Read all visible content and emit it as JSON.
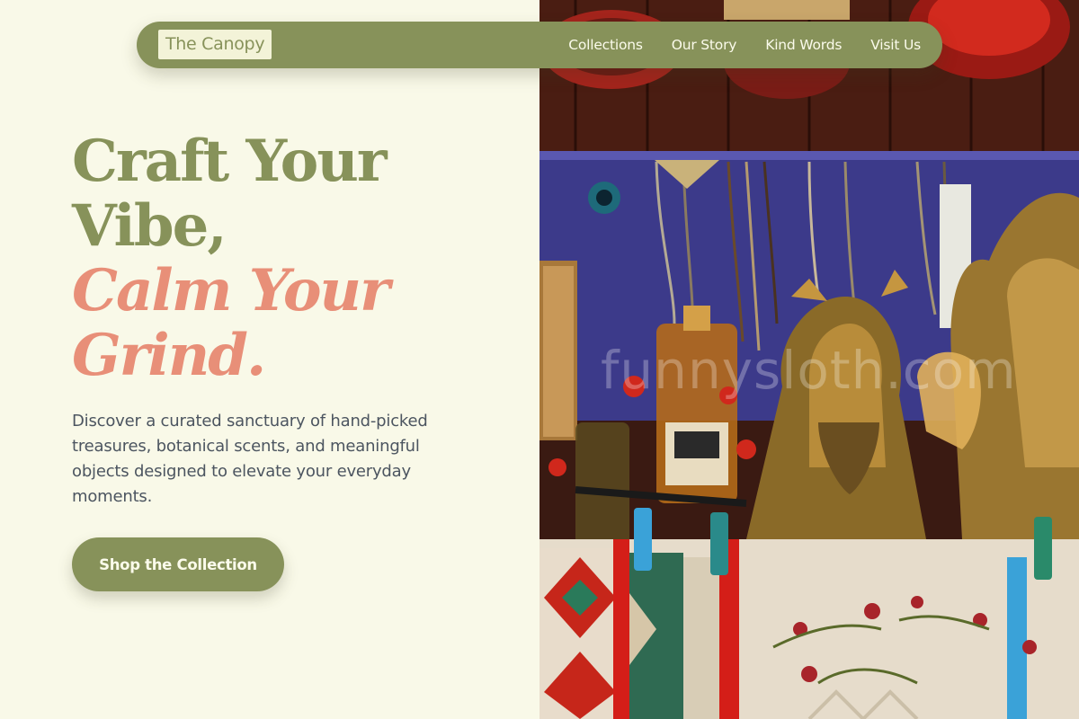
{
  "brand": {
    "logo_text": "The Canopy"
  },
  "nav": {
    "items": [
      {
        "label": "Collections"
      },
      {
        "label": "Our Story"
      },
      {
        "label": "Kind Words"
      },
      {
        "label": "Visit Us"
      }
    ]
  },
  "hero": {
    "title_line1": "Craft Your Vibe,",
    "title_line2": "Calm Your Grind.",
    "subtitle": "Discover a curated sanctuary of hand-picked treasures, botanical scents, and meaningful objects designed to elevate your everyday moments.",
    "cta_label": "Shop the Collection"
  },
  "image": {
    "watermark": "funnysloth.com"
  },
  "colors": {
    "background": "#f9f9e8",
    "accent": "#87925a",
    "highlight": "#e88f78",
    "body_text": "#4c5560"
  }
}
